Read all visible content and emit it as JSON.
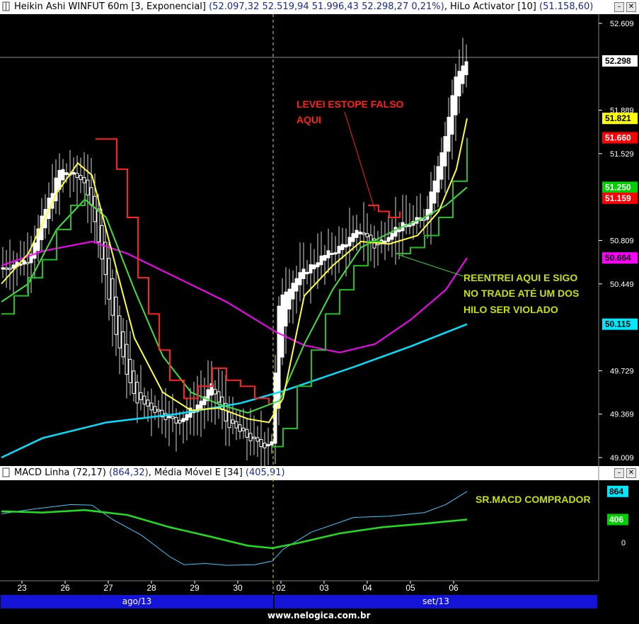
{
  "main_panel": {
    "title": "Heikin Ashi WINFUT 60m [3, Exponencial]",
    "ohlc": "(52.097,32  52.519,94  51.996,43  52.298,27  0,21%)",
    "study": "HiLo Activator [10]",
    "study_value": "(51.158,60)",
    "y_ticks": [
      "52.609",
      "51.889",
      "51.529",
      "50.809",
      "50.449",
      "49.729",
      "49.369",
      "49.009"
    ],
    "price_tags": [
      {
        "text": "52.298",
        "value": 52298,
        "bg": "#ffffff",
        "fg": "#000000"
      },
      {
        "text": "51.821",
        "value": 51821,
        "bg": "#ffff00",
        "fg": "#000000"
      },
      {
        "text": "51.660",
        "value": 51660,
        "bg": "#ff0000",
        "fg": "#ffffff"
      },
      {
        "text": "51.250",
        "value": 51250,
        "bg": "#00d000",
        "fg": "#ffffff"
      },
      {
        "text": "51.159",
        "value": 51159,
        "bg": "#ff0000",
        "fg": "#ffffff"
      },
      {
        "text": "50.664",
        "value": 50664,
        "bg": "#ff00ff",
        "fg": "#000000"
      },
      {
        "text": "50.115",
        "value": 50115,
        "bg": "#00e8ff",
        "fg": "#000000"
      }
    ],
    "annotations": {
      "stop_line1": "LEVEI ESTOPE FALSO",
      "stop_line2": "AQUI",
      "reentry_line1": "REENTREI AQUI E SIGO",
      "reentry_line2": "NO TRADE ATÉ UM DOS",
      "reentry_line3": "HILO SER VIOLADO"
    }
  },
  "macd_panel": {
    "title": "MACD Linha (72,17)",
    "value": "(864,32)",
    "avg_title": "Média Móvel E [34]",
    "avg_value": "(405,91)",
    "tags": [
      {
        "text": "864",
        "value": 864,
        "bg": "#00e8ff",
        "fg": "#000000"
      },
      {
        "text": "406",
        "value": 406,
        "bg": "#00d000",
        "fg": "#ffffff"
      }
    ],
    "zero_label": "0",
    "annotation": "SR.MACD COMPRADOR"
  },
  "x_axis": {
    "day_labels": [
      "23",
      "26",
      "27",
      "28",
      "29",
      "30",
      "02",
      "03",
      "04",
      "05",
      "06"
    ],
    "months": [
      "ago/13",
      "set/13"
    ]
  },
  "footer": "www.nelogica.com.br",
  "colors": {
    "background": "#000000",
    "candle_body": "#ffffff",
    "hilo_red": "#ff2020",
    "hilo_green": "#20c020",
    "ema_yellow": "#ffff40",
    "ema_green": "#40e040",
    "ma_magenta": "#ff00ff",
    "ma_cyan": "#00e0ff",
    "annotation_red": "#ff2020",
    "annotation_green": "#c8e000",
    "macd_line": "#40c8ff",
    "macd_avg": "#20e020"
  },
  "chart_data": {
    "type": "line",
    "x_categories": [
      "23",
      "26",
      "27",
      "28",
      "29",
      "30",
      "02",
      "03",
      "04",
      "05",
      "06"
    ],
    "ylim": [
      49009,
      52609
    ],
    "series": [
      {
        "name": "Heikin Ashi close (approx)",
        "values": [
          50580,
          51380,
          50800,
          49600,
          49350,
          49280,
          50200,
          50650,
          50900,
          50950,
          52298
        ]
      },
      {
        "name": "HiLo Activator [10]",
        "values": [
          50400,
          51650,
          50600,
          49700,
          49780,
          49500,
          49800,
          50400,
          50800,
          51000,
          51159
        ]
      },
      {
        "name": "MACD Linha (72,17)",
        "values": [
          420,
          600,
          300,
          -250,
          -280,
          -250,
          10,
          560,
          700,
          720,
          864
        ]
      },
      {
        "name": "Média Móvel E [34]",
        "values": [
          520,
          520,
          500,
          200,
          -120,
          -220,
          -150,
          150,
          330,
          360,
          406
        ]
      }
    ]
  }
}
